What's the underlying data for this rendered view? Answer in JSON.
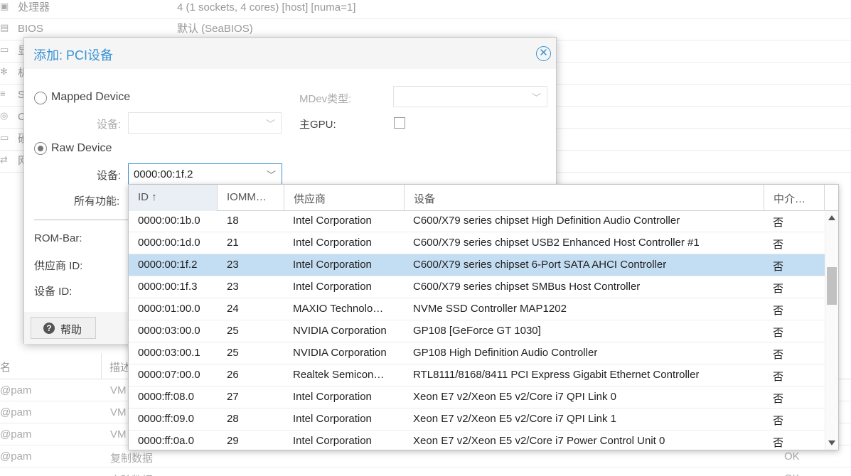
{
  "background": {
    "config_rows": [
      {
        "icon": "cpu-icon",
        "label": "处理器",
        "value": "4 (1 sockets, 4 cores) [host] [numa=1]"
      },
      {
        "icon": "chip-icon",
        "label": "BIOS",
        "value": "默认 (SeaBIOS)"
      },
      {
        "icon": "monitor-icon",
        "label": "显",
        "value": ""
      },
      {
        "icon": "gear-icon",
        "label": "机",
        "value": ""
      },
      {
        "icon": "database-icon",
        "label": "S",
        "value": ""
      },
      {
        "icon": "disc-icon",
        "label": "C",
        "value": ""
      },
      {
        "icon": "hdd-icon",
        "label": "硬",
        "value": ""
      },
      {
        "icon": "exchange-icon",
        "label": "网",
        "value": ""
      }
    ],
    "tasks_grid": {
      "headers": [
        "名",
        "描述"
      ],
      "rows": [
        {
          "user": "@pam",
          "desc": "VM",
          "status": ""
        },
        {
          "user": "@pam",
          "desc": "VM",
          "status": ""
        },
        {
          "user": "@pam",
          "desc": "VM",
          "status": ""
        },
        {
          "user": "@pam",
          "desc": "复制数据",
          "status": "OK"
        },
        {
          "user": "",
          "desc": "实验数据",
          "status": "OK"
        }
      ]
    }
  },
  "dialog": {
    "title": "添加: PCI设备",
    "mapped_device_label": "Mapped Device",
    "raw_device_label": "Raw Device",
    "mapped_device_field_label": "设备:",
    "raw_device_field_label": "设备:",
    "raw_device_value": "0000:00:1f.2",
    "all_functions_label": "所有功能:",
    "mdev_label": "MDev类型:",
    "primary_gpu_label": "主GPU:",
    "rombar_label": "ROM-Bar:",
    "vendor_id_label": "供应商 ID:",
    "device_id_label": "设备 ID:",
    "help_label": "帮助"
  },
  "picker": {
    "headers": {
      "id": "ID",
      "iommu": "IOMM…",
      "vendor": "供应商",
      "device": "设备",
      "mediated": "中介…"
    },
    "rows": [
      {
        "id": "0000:00:1b.0",
        "iommu": "18",
        "vendor": "Intel Corporation",
        "device": "C600/X79 series chipset High Definition Audio Controller",
        "mediated": "否"
      },
      {
        "id": "0000:00:1d.0",
        "iommu": "21",
        "vendor": "Intel Corporation",
        "device": "C600/X79 series chipset USB2 Enhanced Host Controller #1",
        "mediated": "否"
      },
      {
        "id": "0000:00:1f.2",
        "iommu": "23",
        "vendor": "Intel Corporation",
        "device": "C600/X79 series chipset 6-Port SATA AHCI Controller",
        "mediated": "否"
      },
      {
        "id": "0000:00:1f.3",
        "iommu": "23",
        "vendor": "Intel Corporation",
        "device": "C600/X79 series chipset SMBus Host Controller",
        "mediated": "否"
      },
      {
        "id": "0000:01:00.0",
        "iommu": "24",
        "vendor": "MAXIO Technolo…",
        "device": "NVMe SSD Controller MAP1202",
        "mediated": "否"
      },
      {
        "id": "0000:03:00.0",
        "iommu": "25",
        "vendor": "NVIDIA Corporation",
        "device": "GP108 [GeForce GT 1030]",
        "mediated": "否"
      },
      {
        "id": "0000:03:00.1",
        "iommu": "25",
        "vendor": "NVIDIA Corporation",
        "device": "GP108 High Definition Audio Controller",
        "mediated": "否"
      },
      {
        "id": "0000:07:00.0",
        "iommu": "26",
        "vendor": "Realtek Semicon…",
        "device": "RTL8111/8168/8411 PCI Express Gigabit Ethernet Controller",
        "mediated": "否"
      },
      {
        "id": "0000:ff:08.0",
        "iommu": "27",
        "vendor": "Intel Corporation",
        "device": "Xeon E7 v2/Xeon E5 v2/Core i7 QPI Link 0",
        "mediated": "否"
      },
      {
        "id": "0000:ff:09.0",
        "iommu": "28",
        "vendor": "Intel Corporation",
        "device": "Xeon E7 v2/Xeon E5 v2/Core i7 QPI Link 1",
        "mediated": "否"
      },
      {
        "id": "0000:ff:0a.0",
        "iommu": "29",
        "vendor": "Intel Corporation",
        "device": "Xeon E7 v2/Xeon E5 v2/Core i7 Power Control Unit 0",
        "mediated": "否"
      }
    ]
  }
}
